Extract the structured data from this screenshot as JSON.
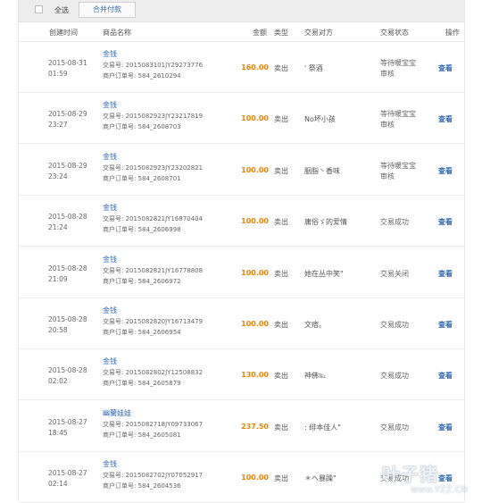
{
  "toolbar": {
    "select_all": "全选",
    "merge_pay": "合并付款"
  },
  "columns": {
    "created": "创建时间",
    "product": "商品名称",
    "amount": "金额",
    "type": "类型",
    "party": "交易对方",
    "status": "交易状态",
    "action": "操作"
  },
  "rows": [
    {
      "date": "2015-08-31",
      "time": "01:59",
      "product": "金钱",
      "txno": "交易号: 2015083101JY29273776",
      "merch": "商户订单号: 584_2610294",
      "amount": "160.00",
      "type": "卖出",
      "party": "' 祭酒",
      "status1": "等待暖宝宝",
      "status2": "审核",
      "action": "查看"
    },
    {
      "date": "2015-08-29",
      "time": "23:27",
      "product": "金钱",
      "txno": "交易号: 2015082923JY23217819",
      "merch": "商户订单号: 584_2608703",
      "amount": "100.00",
      "type": "卖出",
      "party": "No坏小孩",
      "status1": "等待暖宝宝",
      "status2": "审核",
      "action": "查看"
    },
    {
      "date": "2015-08-29",
      "time": "23:24",
      "product": "金钱",
      "txno": "交易号: 2015082923JY23202821",
      "merch": "商户订单号: 584_2608701",
      "amount": "100.00",
      "type": "卖出",
      "party": "胭脂丶香味",
      "status1": "等待暖宝宝",
      "status2": "审核",
      "action": "查看"
    },
    {
      "date": "2015-08-28",
      "time": "21:24",
      "product": "金钱",
      "txno": "交易号: 2015082821JY16870404",
      "merch": "商户订单号: 584_2606998",
      "amount": "100.00",
      "type": "卖出",
      "party": "庸俗ゞ的爱情",
      "status1": "交易成功",
      "status2": "",
      "action": "查看"
    },
    {
      "date": "2015-08-28",
      "time": "21:09",
      "product": "金钱",
      "txno": "交易号: 2015082821JY16778808",
      "merch": "商户订单号: 584_2606972",
      "amount": "100.00",
      "type": "卖出",
      "party": "她在丛中笑\"",
      "status1": "交易关闭",
      "status2": "",
      "action": "查看"
    },
    {
      "date": "2015-08-28",
      "time": "20:58",
      "product": "金钱",
      "txno": "交易号: 2015082820JY16713479",
      "merch": "商户订单号: 584_2606954",
      "amount": "100.00",
      "type": "卖出",
      "party": "文痞。",
      "status1": "交易成功",
      "status2": "",
      "action": "查看"
    },
    {
      "date": "2015-08-28",
      "time": "02:02",
      "product": "金钱",
      "txno": "交易号: 2015082802JY12508832",
      "merch": "商户订单号: 584_2605879",
      "amount": "130.00",
      "type": "卖出",
      "party": "神佛℡",
      "status1": "交易成功",
      "status2": "",
      "action": "查看"
    },
    {
      "date": "2015-08-27",
      "time": "18:45",
      "product": "幽蘭娃娃",
      "txno": "交易号: 2015082718JY09733067",
      "merch": "商户订单号: 584_2605081",
      "amount": "237.50",
      "type": "卖出",
      "party": ": 绯本佳人\"",
      "status1": "交易成功",
      "status2": "",
      "action": "查看"
    },
    {
      "date": "2015-08-27",
      "time": "02:14",
      "product": "金钱",
      "txno": "交易号: 2015082702JY07052917",
      "merch": "商户订单号: 584_2604536",
      "amount": "100.00",
      "type": "卖出",
      "party": "＊へ暴躁\"",
      "status1": "交易成功",
      "status2": "",
      "action": "查看"
    }
  ],
  "watermark": {
    "text": "叶子猪",
    "url": "www.YZZ.CN"
  }
}
